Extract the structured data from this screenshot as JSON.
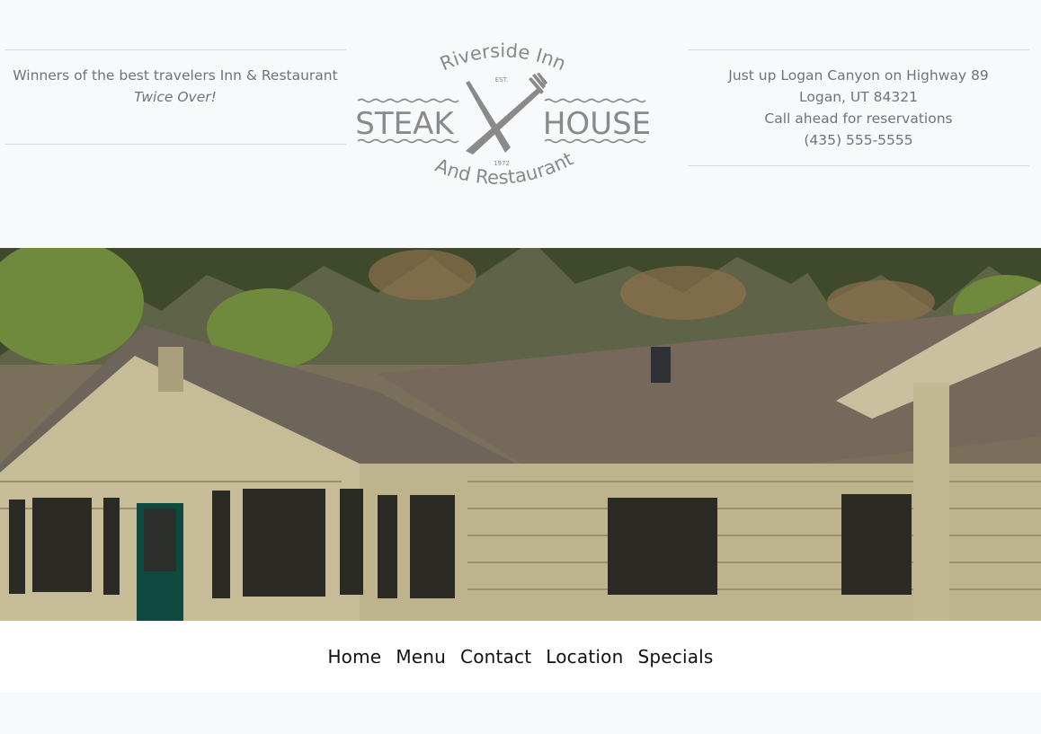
{
  "header": {
    "left_info": {
      "line1": "Winners of the best travelers Inn & Restaurant",
      "line2": "Twice Over!"
    },
    "right_info": {
      "line1": "Just up Logan Canyon on Highway 89",
      "line2": "Logan, UT 84321",
      "line3": "Call ahead for reservations",
      "line4": "(435) 555-5555"
    },
    "logo": {
      "top_arc": "Riverside Inn",
      "est": "EST.",
      "left_word": "STEAK",
      "right_word": "HOUSE",
      "year": "1972",
      "bottom_arc": "And Restaurant",
      "color": "#8a8a8a"
    }
  },
  "nav": {
    "items": [
      {
        "label": "Home"
      },
      {
        "label": "Menu"
      },
      {
        "label": "Contact"
      },
      {
        "label": "Location"
      },
      {
        "label": "Specials"
      }
    ]
  }
}
